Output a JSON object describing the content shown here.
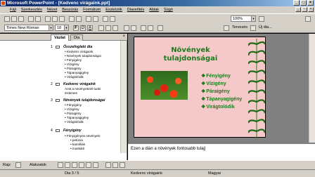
{
  "window": {
    "title": "Microsoft PowerPoint - [Kedvenc virágaink.ppt]"
  },
  "menu": [
    "Fájl",
    "Szerkesztés",
    "Nézet",
    "Beszúrás",
    "Formátum",
    "Eszközök",
    "Diavetítés",
    "Ablak",
    "Súgó"
  ],
  "toolbar": {
    "zoom": "100%",
    "font_name": "Times New Roman",
    "font_size": "18",
    "tervezes_label": "Tervezés",
    "uj_dia_label": "Új dia..."
  },
  "left_pane": {
    "tabs": [
      "Vázlat",
      "Dia"
    ],
    "slides": [
      {
        "num": "1",
        "title": "Összefoglaló dia",
        "bullets": [
          "Kedvenc virágaink",
          "Növények tulajdonságai",
          "Fényigény",
          "Vízigény",
          "Páraigény",
          "Tápanyagigény",
          "Virágtolódik"
        ]
      },
      {
        "num": "2",
        "title": "Kedvenc virágaink",
        "bullets": [
          "Amit a növényeknél tudni érdemes"
        ]
      },
      {
        "num": "3",
        "title": "Növények tulajdonságai",
        "bullets": [
          "Fényigény",
          "Vízigény",
          "Páraigény",
          "Tápanyagigény",
          "Virágtolódik"
        ]
      },
      {
        "num": "4",
        "title": "Fényigény",
        "bullets": [
          "Fényigényes növények:",
          "petúnia",
          "kaméliák",
          "muskátli"
        ]
      }
    ]
  },
  "slide": {
    "title_line1": "Növények",
    "title_line2": "tulajdonságai",
    "bullets": [
      "Fényigény",
      "Vízigény",
      "Páraigény",
      "Tápanyagigény",
      "Virágtolódik"
    ]
  },
  "notes": {
    "text": "Ezen a dián a növények fontosabb tulaj"
  },
  "drawing": {
    "rajz_label": "Rajz",
    "alakzatok_label": "Alakzatok"
  },
  "status": {
    "slide_info": "Dia 3 / 5",
    "design": "Kedvenc virágaink",
    "language": "Magyar"
  },
  "colors": {
    "title_green": "#1d7a1d",
    "slide_bg": "#f5c9c9",
    "titlebar": "#0a246a"
  }
}
